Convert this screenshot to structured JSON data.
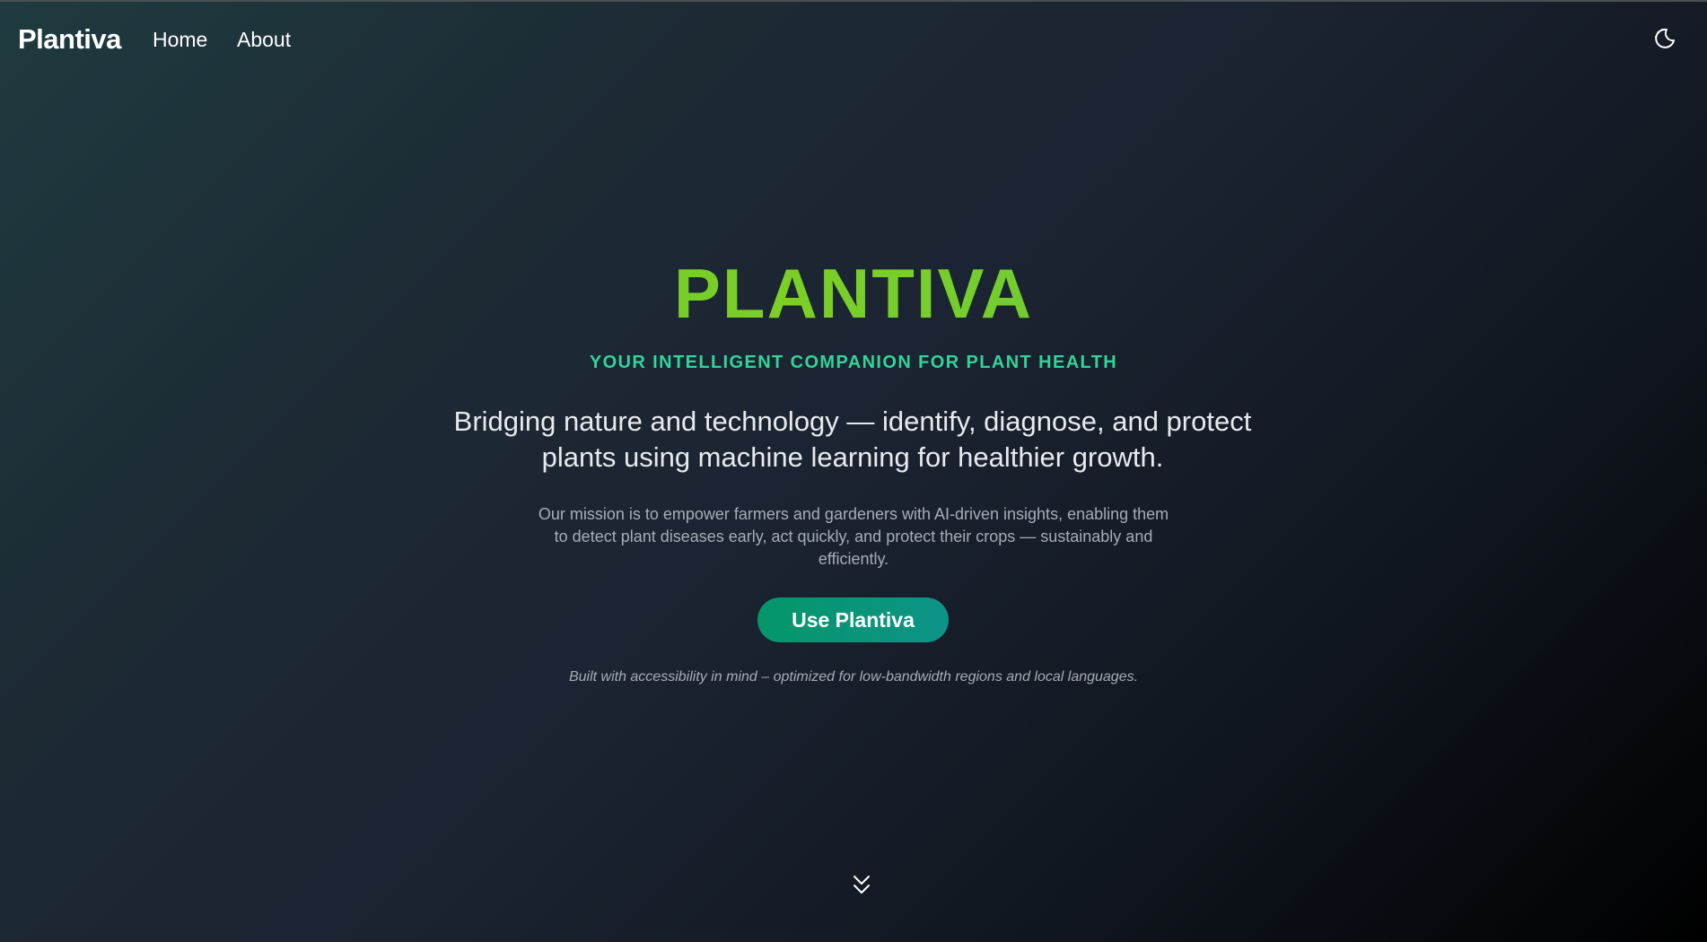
{
  "navbar": {
    "brand": "Plantiva",
    "links": [
      {
        "label": "Home"
      },
      {
        "label": "About"
      }
    ],
    "theme_toggle_icon": "moon-stars-icon"
  },
  "hero": {
    "title": "PLANTIVA",
    "tagline": "YOUR INTELLIGENT COMPANION FOR PLANT HEALTH",
    "lead": "Bridging nature and technology — identify, diagnose, and protect plants using machine learning for healthier growth.",
    "mission": "Our mission is to empower farmers and gardeners with AI-driven insights, enabling them to detect plant diseases early, act quickly, and protect their crops — sustainably and efficiently.",
    "cta_label": "Use Plantiva",
    "footnote": "Built with accessibility in mind – optimized for low-bandwidth regions and local languages.",
    "scroll_icon": "chevron-double-down-icon"
  },
  "colors": {
    "title_gradient": [
      "#42c04a",
      "#7dcf26"
    ],
    "tagline": "#34d399",
    "button": "#059669"
  }
}
